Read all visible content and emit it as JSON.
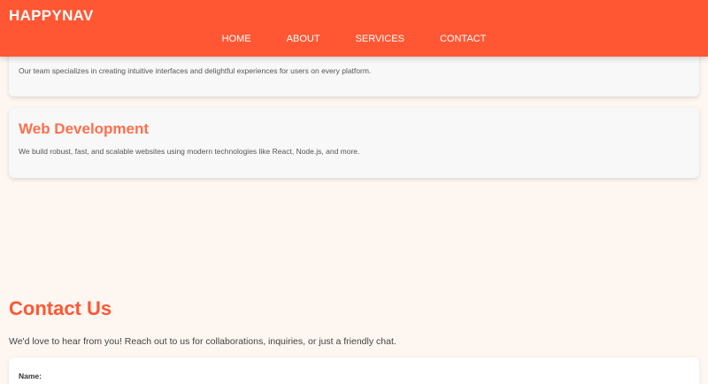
{
  "header": {
    "brand": "HAPPYNAV",
    "nav": [
      "HOME",
      "ABOUT",
      "SERVICES",
      "CONTACT"
    ]
  },
  "services": [
    {
      "title": "",
      "text": "Our team specializes in creating intuitive interfaces and delightful experiences for users on every platform."
    },
    {
      "title": "Web Development",
      "text": "We build robust, fast, and scalable websites using modern technologies like React, Node.js, and more."
    }
  ],
  "contact": {
    "title": "Contact Us",
    "text": "We'd love to hear from you! Reach out to us for collaborations, inquiries, or just a friendly chat.",
    "name_label": "Name:"
  },
  "colors": {
    "brand": "#ff5733",
    "card_title": "#ff6f4d",
    "background": "#fdf6f1"
  }
}
